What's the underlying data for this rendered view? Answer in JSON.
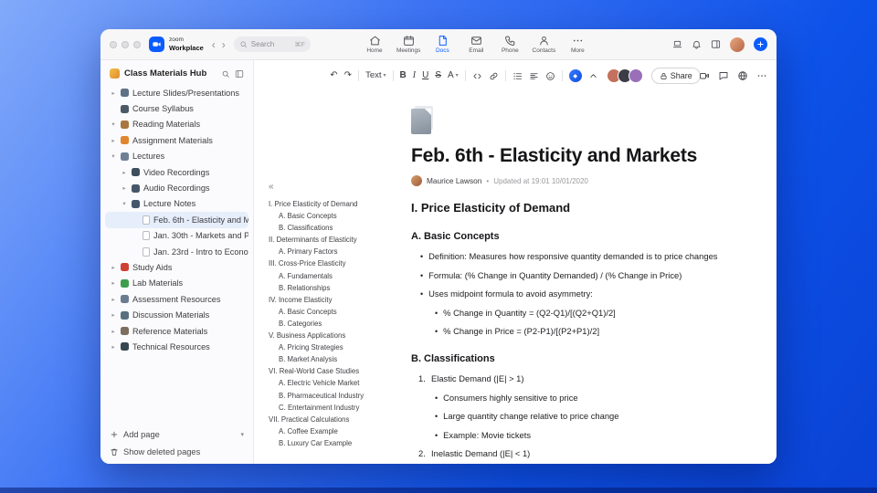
{
  "topbar": {
    "brand_line1": "zoom",
    "brand_line2": "Workplace",
    "search": {
      "placeholder": "Search",
      "shortcut": "⌘F"
    },
    "tabs": [
      {
        "label": "Home",
        "icon": "home",
        "active": false
      },
      {
        "label": "Meetings",
        "icon": "meetings",
        "active": false
      },
      {
        "label": "Docs",
        "icon": "docs",
        "active": true
      },
      {
        "label": "Email",
        "icon": "email",
        "active": false
      },
      {
        "label": "Phone",
        "icon": "phone",
        "active": false
      },
      {
        "label": "Contacts",
        "icon": "contacts",
        "active": false
      },
      {
        "label": "More",
        "icon": "more",
        "active": false
      }
    ]
  },
  "sidebar": {
    "title": "Class Materials Hub",
    "items": [
      {
        "label": "Lecture Slides/Presentations",
        "level": 0,
        "chevron": "right",
        "icon": "presentation-icon",
        "icon_color": "#5f7184"
      },
      {
        "label": "Course Syllabus",
        "level": 0,
        "chevron": "none",
        "icon": "syllabus-icon",
        "icon_color": "#4c5a66"
      },
      {
        "label": "Reading Materials",
        "level": 0,
        "chevron": "down",
        "icon": "book-icon",
        "icon_color": "#a9773f"
      },
      {
        "label": "Assignment Materials",
        "level": 0,
        "chevron": "right",
        "icon": "assignment-icon",
        "icon_color": "#e0862f"
      },
      {
        "label": "Lectures",
        "level": 0,
        "chevron": "down",
        "icon": "lectures-icon",
        "icon_color": "#6e7f96"
      },
      {
        "label": "Video Recordings",
        "level": 1,
        "chevron": "right",
        "icon": "video-icon",
        "icon_color": "#3e4e5e"
      },
      {
        "label": "Audio Recordings",
        "level": 1,
        "chevron": "right",
        "icon": "audio-icon",
        "icon_color": "#46566a"
      },
      {
        "label": "Lecture Notes",
        "level": 1,
        "chevron": "down",
        "icon": "notes-icon",
        "icon_color": "#44566b"
      },
      {
        "label": "Feb. 6th - Elasticity and M...",
        "level": 2,
        "chevron": "none",
        "page": true,
        "selected": true
      },
      {
        "label": "Jan. 30th - Markets and P...",
        "level": 2,
        "chevron": "none",
        "page": true
      },
      {
        "label": "Jan. 23rd - Intro to Econo...",
        "level": 2,
        "chevron": "none",
        "page": true
      },
      {
        "label": "Study Aids",
        "level": 0,
        "chevron": "right",
        "icon": "study-aids-icon",
        "icon_color": "#cf4034"
      },
      {
        "label": "Lab Materials",
        "level": 0,
        "chevron": "right",
        "icon": "lab-icon",
        "icon_color": "#3e9e4e"
      },
      {
        "label": "Assessment Resources",
        "level": 0,
        "chevron": "right",
        "icon": "assessment-icon",
        "icon_color": "#6b7c90"
      },
      {
        "label": "Discussion Materials",
        "level": 0,
        "chevron": "right",
        "icon": "discussion-icon",
        "icon_color": "#58707f"
      },
      {
        "label": "Reference Materials",
        "level": 0,
        "chevron": "right",
        "icon": "reference-icon",
        "icon_color": "#7c6f5f"
      },
      {
        "label": "Technical Resources",
        "level": 0,
        "chevron": "right",
        "icon": "technical-icon",
        "icon_color": "#37474f"
      }
    ],
    "footer": {
      "add_page": "Add page",
      "show_deleted": "Show deleted pages"
    }
  },
  "toolbar": {
    "text_style_label": "Text",
    "share_label": "Share",
    "collaborators": [
      {
        "color": "#c4705c"
      },
      {
        "color": "#3c3c46"
      },
      {
        "color": "#9a6fb8"
      }
    ]
  },
  "outline": {
    "items": [
      {
        "text": "I. Price Elasticity of Demand",
        "level": 0
      },
      {
        "text": "A. Basic Concepts",
        "level": 1
      },
      {
        "text": "B. Classifications",
        "level": 1
      },
      {
        "text": "II. Determinants of Elasticity",
        "level": 0
      },
      {
        "text": "A. Primary Factors",
        "level": 1
      },
      {
        "text": "III. Cross-Price Elasticity",
        "level": 0
      },
      {
        "text": "A. Fundamentals",
        "level": 1
      },
      {
        "text": "B. Relationships",
        "level": 1
      },
      {
        "text": "IV. Income Elasticity",
        "level": 0
      },
      {
        "text": "A. Basic Concepts",
        "level": 1
      },
      {
        "text": "B. Categories",
        "level": 1
      },
      {
        "text": "V. Business Applications",
        "level": 0
      },
      {
        "text": "A. Pricing Strategies",
        "level": 1
      },
      {
        "text": "B. Market Analysis",
        "level": 1
      },
      {
        "text": "VI. Real-World Case Studies",
        "level": 0
      },
      {
        "text": "A. Electric Vehicle Market",
        "level": 1
      },
      {
        "text": "B. Pharmaceutical Industry",
        "level": 1
      },
      {
        "text": "C. Entertainment Industry",
        "level": 1
      },
      {
        "text": "VII. Practical Calculations",
        "level": 0
      },
      {
        "text": "A. Coffee Example",
        "level": 1
      },
      {
        "text": "B. Luxury Car Example",
        "level": 1
      }
    ]
  },
  "document": {
    "title": "Feb. 6th - Elasticity and Markets",
    "author": "Maurice Lawson",
    "meta_separator": "•",
    "updated": "Updated at 19:01 10/01/2020",
    "blocks": [
      {
        "type": "h2",
        "text": "I. Price Elasticity of Demand"
      },
      {
        "type": "h3",
        "text": "A. Basic Concepts"
      },
      {
        "type": "li1",
        "text": "Definition: Measures how responsive quantity demanded is to price changes"
      },
      {
        "type": "li1",
        "text": "Formula: (% Change in Quantity Demanded) / (% Change in Price)"
      },
      {
        "type": "li1",
        "text": "Uses midpoint formula to avoid asymmetry:"
      },
      {
        "type": "li2",
        "text": "% Change in Quantity = (Q2-Q1)/[(Q2+Q1)/2]"
      },
      {
        "type": "li2",
        "text": "% Change in Price = (P2-P1)/[(P2+P1)/2]"
      },
      {
        "type": "h3",
        "text": "B. Classifications"
      },
      {
        "type": "num",
        "num": "1.",
        "text": "Elastic Demand (|E| > 1)"
      },
      {
        "type": "li2",
        "text": "Consumers highly sensitive to price"
      },
      {
        "type": "li2",
        "text": "Large quantity change relative to price change"
      },
      {
        "type": "li2",
        "text": "Example: Movie tickets"
      },
      {
        "type": "num",
        "num": "2.",
        "text": "Inelastic Demand (|E| < 1)"
      }
    ]
  },
  "colors": {
    "accent": "#0b5cff",
    "selected_row": "#e7eefb"
  }
}
